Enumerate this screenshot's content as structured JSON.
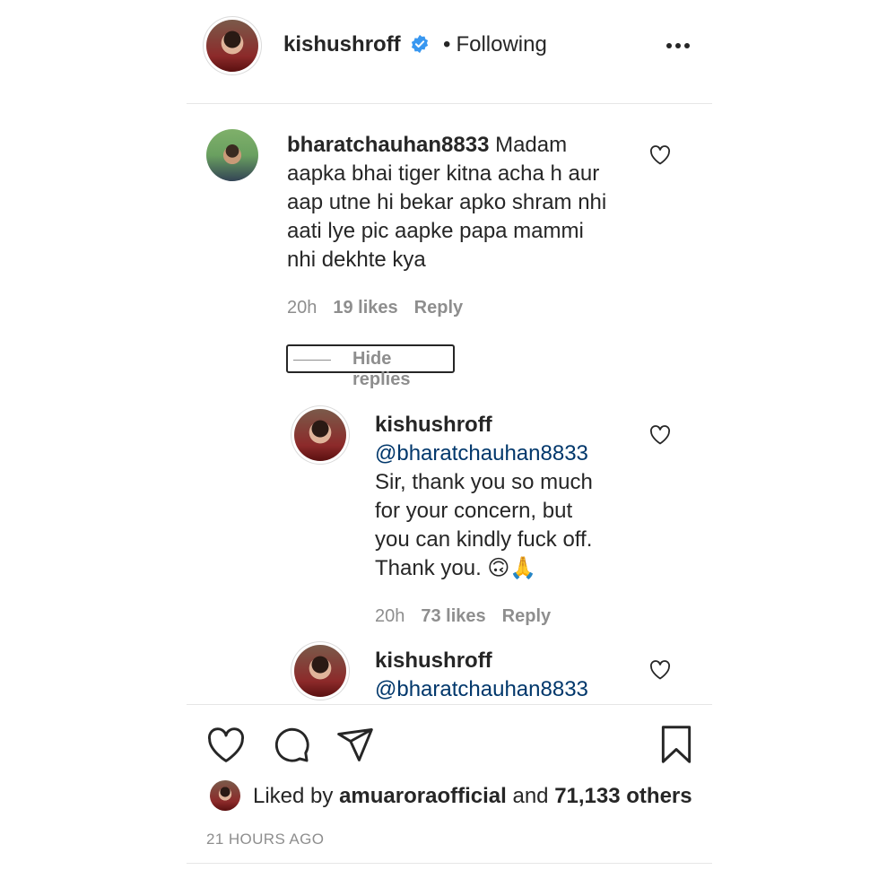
{
  "header": {
    "username": "kishushroff",
    "separator": "•",
    "follow_status": "Following",
    "more_icon": "more-horizontal-icon",
    "verified_icon": "verified-badge-icon",
    "colors": {
      "verified": "#3897f0"
    }
  },
  "comment": {
    "username": "bharatchauhan8833",
    "lines": [
      "Madam",
      "aapka bhai tiger kitna acha h aur",
      "aap utne hi bekar apko shram nhi",
      "aati  lye pic aapke papa mammi",
      "nhi dekhte kya"
    ],
    "time": "20h",
    "likes": "19 likes",
    "reply": "Reply",
    "hide_replies": "Hide replies"
  },
  "replies": [
    {
      "username": "kishushroff",
      "mention": "@bharatchauhan8833",
      "lines": [
        "Sir, thank you so much",
        "for your concern, but",
        "you can kindly fuck off.",
        "Thank you. 🙃🙏"
      ],
      "time": "20h",
      "likes": "73 likes",
      "reply": "Reply"
    },
    {
      "username": "kishushroff",
      "mention": "@bharatchauhan8833"
    }
  ],
  "actions": {
    "icons": [
      "heart-icon",
      "comment-icon",
      "share-icon",
      "bookmark-icon"
    ]
  },
  "likes": {
    "prefix": "Liked by",
    "user": "amuaroraofficial",
    "joiner": "and",
    "others": "71,133 others"
  },
  "timestamp": "21 HOURS AGO"
}
